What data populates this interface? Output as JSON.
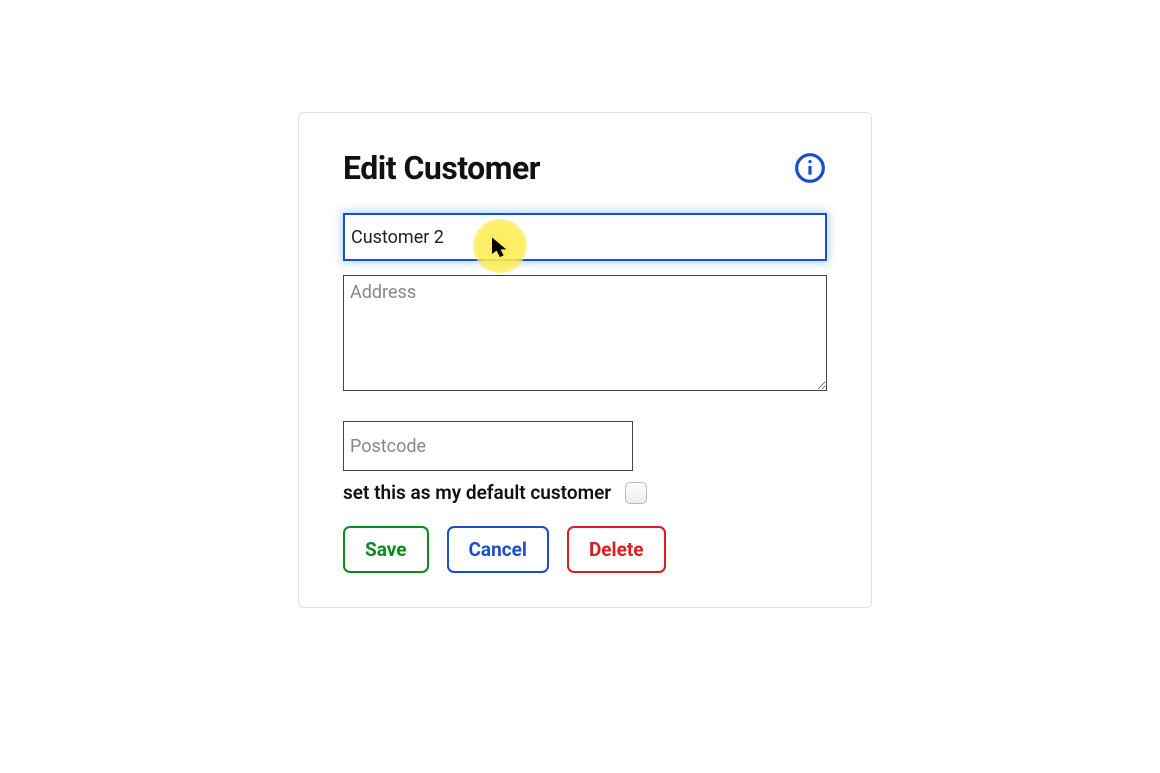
{
  "title": "Edit Customer",
  "fields": {
    "name": {
      "value": "Customer 2",
      "placeholder": ""
    },
    "address": {
      "value": "",
      "placeholder": "Address"
    },
    "postcode": {
      "value": "",
      "placeholder": "Postcode"
    },
    "default_checkbox": {
      "label": "set this as my default customer",
      "checked": false
    }
  },
  "buttons": {
    "save": "Save",
    "cancel": "Cancel",
    "delete": "Delete"
  },
  "colors": {
    "primary_blue": "#1a4fcc",
    "save_green": "#0a8a1f",
    "delete_red": "#d91e1e",
    "highlight_yellow": "#ffeb50"
  }
}
